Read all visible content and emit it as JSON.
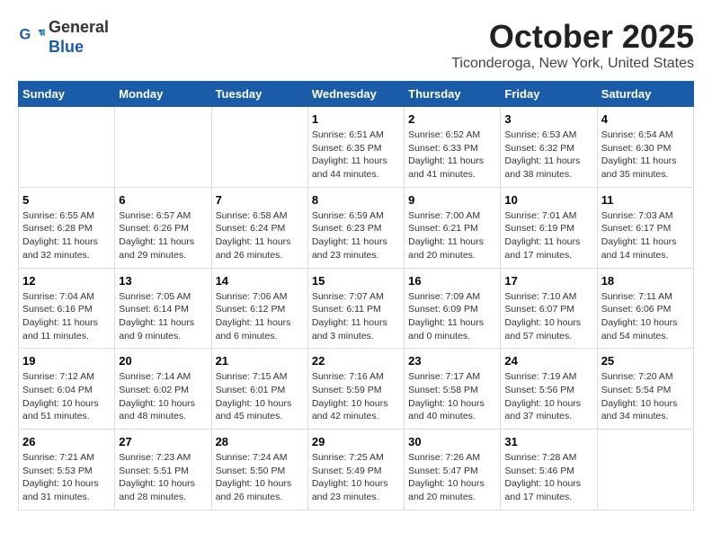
{
  "header": {
    "logo_general": "General",
    "logo_blue": "Blue",
    "month_title": "October 2025",
    "location": "Ticonderoga, New York, United States"
  },
  "days_of_week": [
    "Sunday",
    "Monday",
    "Tuesday",
    "Wednesday",
    "Thursday",
    "Friday",
    "Saturday"
  ],
  "weeks": [
    [
      {
        "day": "",
        "content": ""
      },
      {
        "day": "",
        "content": ""
      },
      {
        "day": "",
        "content": ""
      },
      {
        "day": "1",
        "content": "Sunrise: 6:51 AM\nSunset: 6:35 PM\nDaylight: 11 hours and 44 minutes."
      },
      {
        "day": "2",
        "content": "Sunrise: 6:52 AM\nSunset: 6:33 PM\nDaylight: 11 hours and 41 minutes."
      },
      {
        "day": "3",
        "content": "Sunrise: 6:53 AM\nSunset: 6:32 PM\nDaylight: 11 hours and 38 minutes."
      },
      {
        "day": "4",
        "content": "Sunrise: 6:54 AM\nSunset: 6:30 PM\nDaylight: 11 hours and 35 minutes."
      }
    ],
    [
      {
        "day": "5",
        "content": "Sunrise: 6:55 AM\nSunset: 6:28 PM\nDaylight: 11 hours and 32 minutes."
      },
      {
        "day": "6",
        "content": "Sunrise: 6:57 AM\nSunset: 6:26 PM\nDaylight: 11 hours and 29 minutes."
      },
      {
        "day": "7",
        "content": "Sunrise: 6:58 AM\nSunset: 6:24 PM\nDaylight: 11 hours and 26 minutes."
      },
      {
        "day": "8",
        "content": "Sunrise: 6:59 AM\nSunset: 6:23 PM\nDaylight: 11 hours and 23 minutes."
      },
      {
        "day": "9",
        "content": "Sunrise: 7:00 AM\nSunset: 6:21 PM\nDaylight: 11 hours and 20 minutes."
      },
      {
        "day": "10",
        "content": "Sunrise: 7:01 AM\nSunset: 6:19 PM\nDaylight: 11 hours and 17 minutes."
      },
      {
        "day": "11",
        "content": "Sunrise: 7:03 AM\nSunset: 6:17 PM\nDaylight: 11 hours and 14 minutes."
      }
    ],
    [
      {
        "day": "12",
        "content": "Sunrise: 7:04 AM\nSunset: 6:16 PM\nDaylight: 11 hours and 11 minutes."
      },
      {
        "day": "13",
        "content": "Sunrise: 7:05 AM\nSunset: 6:14 PM\nDaylight: 11 hours and 9 minutes."
      },
      {
        "day": "14",
        "content": "Sunrise: 7:06 AM\nSunset: 6:12 PM\nDaylight: 11 hours and 6 minutes."
      },
      {
        "day": "15",
        "content": "Sunrise: 7:07 AM\nSunset: 6:11 PM\nDaylight: 11 hours and 3 minutes."
      },
      {
        "day": "16",
        "content": "Sunrise: 7:09 AM\nSunset: 6:09 PM\nDaylight: 11 hours and 0 minutes."
      },
      {
        "day": "17",
        "content": "Sunrise: 7:10 AM\nSunset: 6:07 PM\nDaylight: 10 hours and 57 minutes."
      },
      {
        "day": "18",
        "content": "Sunrise: 7:11 AM\nSunset: 6:06 PM\nDaylight: 10 hours and 54 minutes."
      }
    ],
    [
      {
        "day": "19",
        "content": "Sunrise: 7:12 AM\nSunset: 6:04 PM\nDaylight: 10 hours and 51 minutes."
      },
      {
        "day": "20",
        "content": "Sunrise: 7:14 AM\nSunset: 6:02 PM\nDaylight: 10 hours and 48 minutes."
      },
      {
        "day": "21",
        "content": "Sunrise: 7:15 AM\nSunset: 6:01 PM\nDaylight: 10 hours and 45 minutes."
      },
      {
        "day": "22",
        "content": "Sunrise: 7:16 AM\nSunset: 5:59 PM\nDaylight: 10 hours and 42 minutes."
      },
      {
        "day": "23",
        "content": "Sunrise: 7:17 AM\nSunset: 5:58 PM\nDaylight: 10 hours and 40 minutes."
      },
      {
        "day": "24",
        "content": "Sunrise: 7:19 AM\nSunset: 5:56 PM\nDaylight: 10 hours and 37 minutes."
      },
      {
        "day": "25",
        "content": "Sunrise: 7:20 AM\nSunset: 5:54 PM\nDaylight: 10 hours and 34 minutes."
      }
    ],
    [
      {
        "day": "26",
        "content": "Sunrise: 7:21 AM\nSunset: 5:53 PM\nDaylight: 10 hours and 31 minutes."
      },
      {
        "day": "27",
        "content": "Sunrise: 7:23 AM\nSunset: 5:51 PM\nDaylight: 10 hours and 28 minutes."
      },
      {
        "day": "28",
        "content": "Sunrise: 7:24 AM\nSunset: 5:50 PM\nDaylight: 10 hours and 26 minutes."
      },
      {
        "day": "29",
        "content": "Sunrise: 7:25 AM\nSunset: 5:49 PM\nDaylight: 10 hours and 23 minutes."
      },
      {
        "day": "30",
        "content": "Sunrise: 7:26 AM\nSunset: 5:47 PM\nDaylight: 10 hours and 20 minutes."
      },
      {
        "day": "31",
        "content": "Sunrise: 7:28 AM\nSunset: 5:46 PM\nDaylight: 10 hours and 17 minutes."
      },
      {
        "day": "",
        "content": ""
      }
    ]
  ]
}
